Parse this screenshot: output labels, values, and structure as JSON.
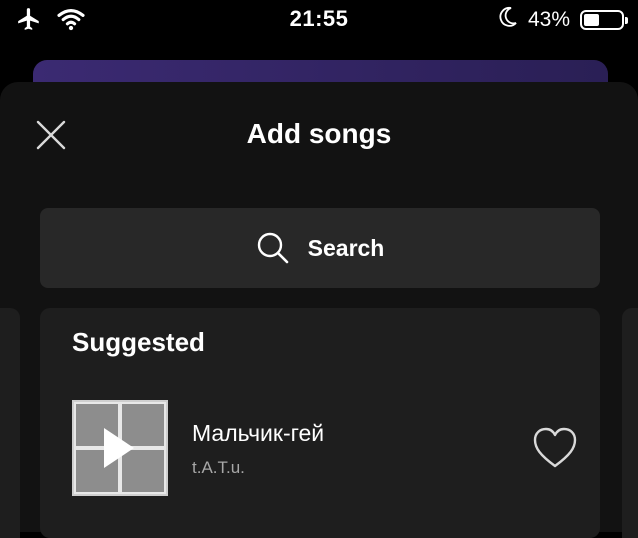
{
  "status_bar": {
    "time": "21:55",
    "battery_percent_label": "43%",
    "battery_level": 0.43,
    "icons": [
      "airplane-icon",
      "wifi-icon",
      "moon-icon",
      "battery-icon"
    ]
  },
  "sheet": {
    "title": "Add songs",
    "close_icon": "close-icon"
  },
  "search": {
    "label": "Search",
    "icon": "search-icon"
  },
  "suggested": {
    "title": "Suggested",
    "tracks": [
      {
        "title": "Мальчик-гей",
        "artist": "t.A.T.u.",
        "liked": false
      }
    ]
  },
  "colors": {
    "background": "#000000",
    "sheet": "#121212",
    "card": "#1e1e1e",
    "search": "#282828",
    "secondary_text": "#a7a7a7"
  }
}
